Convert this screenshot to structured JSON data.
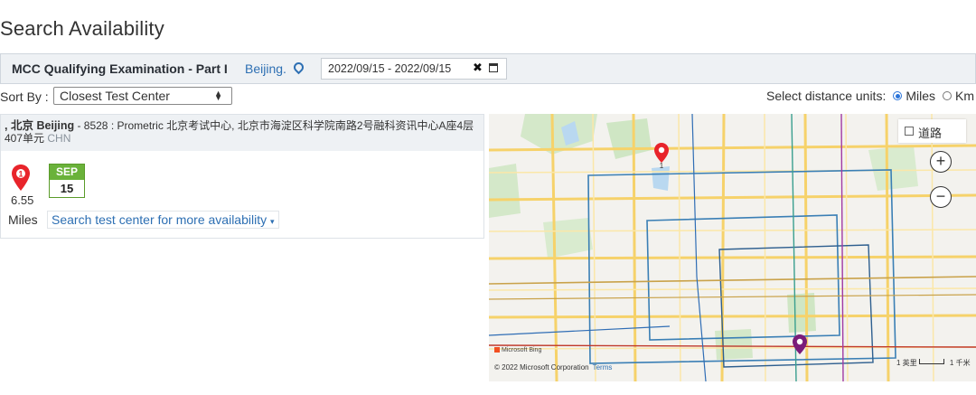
{
  "page": {
    "title": "Search Availability"
  },
  "exam_bar": {
    "name": "MCC Qualifying Examination - Part I",
    "location": "Beijing.",
    "date_range": "2022/09/15 - 2022/09/15",
    "clear_label": "✖"
  },
  "sort": {
    "label": "Sort By :",
    "selected": "Closest Test Center"
  },
  "units": {
    "label": "Select distance units:",
    "options": [
      "Miles",
      "Km"
    ],
    "selected": "Miles"
  },
  "result": {
    "prefix": ", ",
    "city_cn": "北京",
    "city_en": "Beijing",
    "detail": " - 8528 : Prometric 北京考试中心, 北京市海淀区科学院南路2号融科资讯中心A座4层407单元",
    "country": "CHN",
    "marker_number": "1",
    "distance": "6.55",
    "distance_unit": "Miles",
    "date_month": "SEP",
    "date_day": "15",
    "more_link": "Search test center for more availability"
  },
  "map": {
    "type_label": "道路",
    "zoom_in": "+",
    "zoom_out": "−",
    "pin_label": "1",
    "bing_text": "Microsoft Bing",
    "copyright": "© 2022 Microsoft Corporation",
    "terms": "Terms",
    "scale_miles": "1 英里",
    "scale_km": "1 千米",
    "icons": [
      "map-pin-icon",
      "map-pin-purple-icon",
      "plus-icon",
      "minus-icon"
    ]
  },
  "colors": {
    "link": "#2d6fb3",
    "badge_green": "#6ab23a",
    "pin_red": "#e8242b",
    "pin_purple": "#7a1d7a"
  }
}
